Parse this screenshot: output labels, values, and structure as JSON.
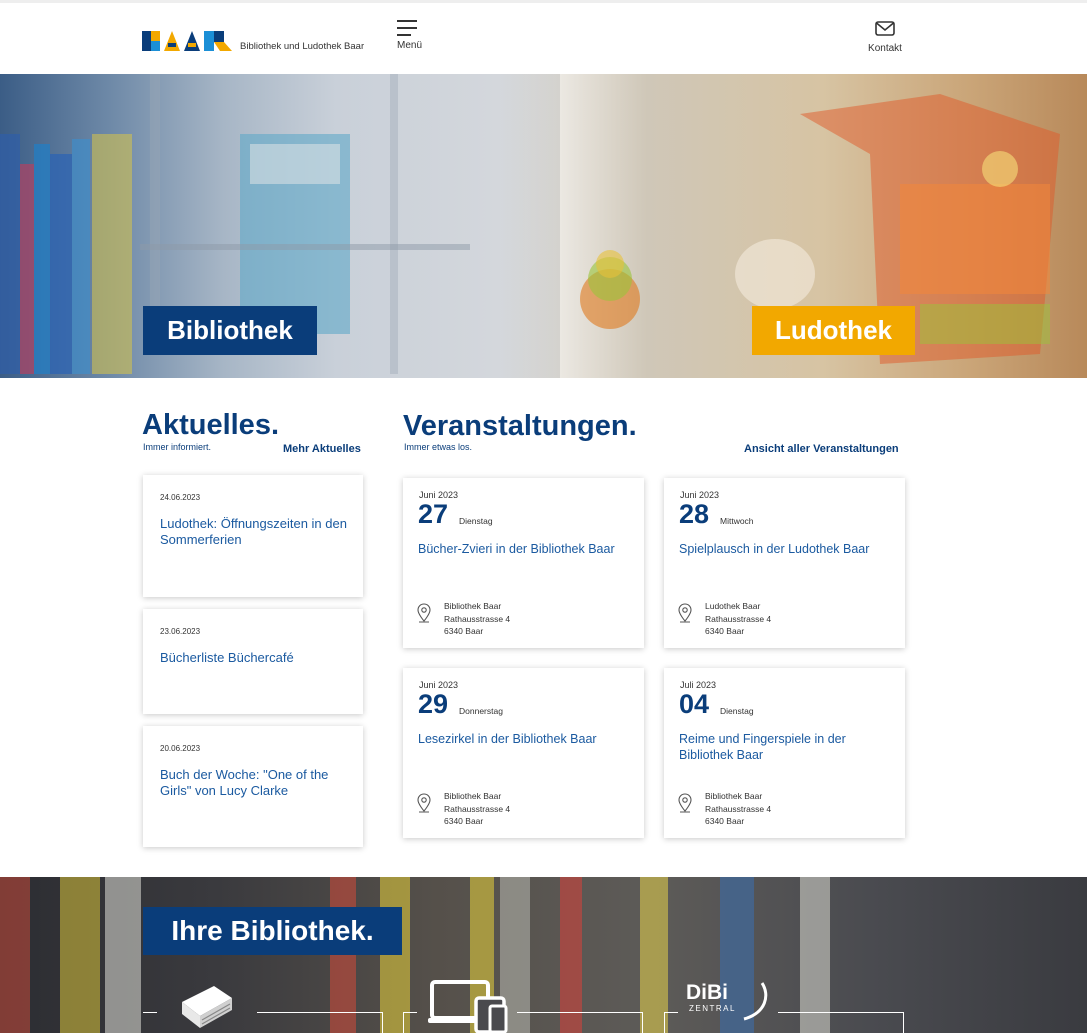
{
  "header": {
    "logo_text": "Bibliothek und Ludothek Baar",
    "menu_label": "Menü",
    "contact_label": "Kontakt",
    "menu_icon": "hamburger-icon",
    "contact_icon": "envelope-icon"
  },
  "hero": {
    "library_button": "Bibliothek",
    "ludothek_button": "Ludothek"
  },
  "news": {
    "title": "Aktuelles.",
    "subtitle": "Immer informiert.",
    "more_link": "Mehr Aktuelles",
    "items": [
      {
        "date": "24.06.2023",
        "title": "Ludothek: Öffnungszeiten in den Sommerferien"
      },
      {
        "date": "23.06.2023",
        "title": "Bücherliste Büchercafé"
      },
      {
        "date": "20.06.2023",
        "title": "Buch der Woche: \"One of the Girls\" von Lucy Clarke"
      }
    ]
  },
  "events": {
    "title": "Veranstaltungen.",
    "subtitle": "Immer etwas los.",
    "all_link": "Ansicht aller Veranstaltungen",
    "items": [
      {
        "month": "Juni 2023",
        "day": "27",
        "weekday": "Dienstag",
        "title": "Bücher-Zvieri in der Bibliothek Baar",
        "address": [
          "Bibliothek Baar",
          "Rathausstrasse 4",
          "6340 Baar"
        ]
      },
      {
        "month": "Juni 2023",
        "day": "28",
        "weekday": "Mittwoch",
        "title": "Spielplausch in der Ludothek Baar",
        "address": [
          "Ludothek Baar",
          "Rathausstrasse 4",
          "6340 Baar"
        ]
      },
      {
        "month": "Juni 2023",
        "day": "29",
        "weekday": "Donnerstag",
        "title": "Lesezirkel in der Bibliothek Baar",
        "address": [
          "Bibliothek Baar",
          "Rathausstrasse 4",
          "6340 Baar"
        ]
      },
      {
        "month": "Juli 2023",
        "day": "04",
        "weekday": "Dienstag",
        "title": "Reime und Fingerspiele in der Bibliothek Baar",
        "address": [
          "Bibliothek Baar",
          "Rathausstrasse 4",
          "6340 Baar"
        ]
      }
    ]
  },
  "library_section": {
    "title": "Ihre Bibliothek.",
    "tiles": [
      {
        "icon": "book-icon"
      },
      {
        "icon": "devices-icon"
      },
      {
        "icon": "dibi-zentral-logo",
        "logo_text": "DiBi",
        "logo_sub": "ZENTRAL"
      }
    ]
  },
  "colors": {
    "brand_blue": "#0a3d7a",
    "link_blue": "#1b5aa0",
    "ludothek_orange": "#f2a800"
  }
}
